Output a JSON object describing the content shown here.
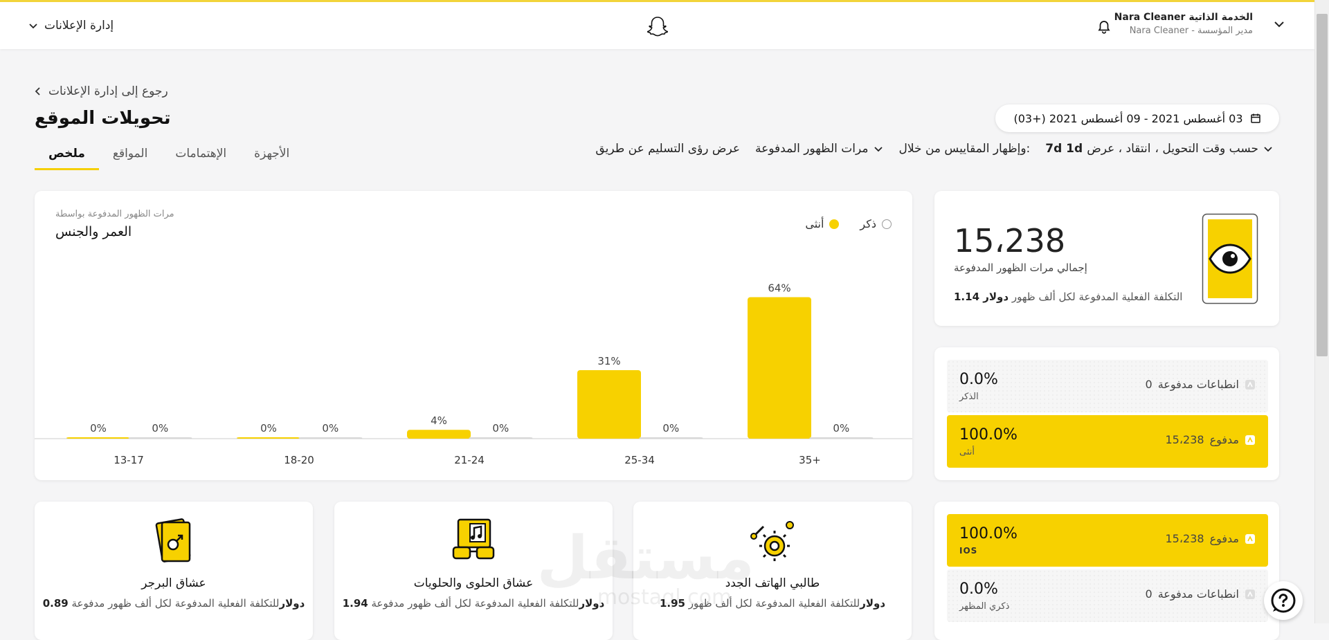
{
  "colors": {
    "accent": "#F7D100",
    "male_dot": "#ffffff",
    "female_dot": "#F7D100",
    "bar": "#F7D100"
  },
  "header": {
    "org_label": "الخدمة الذاتية",
    "org_name": "Nara Cleaner",
    "role_line": "مدير المؤسسة - Nara Cleaner",
    "ads_manager_label": "إدارة الإعلانات",
    "icons": [
      "chevron-down-icon",
      "bell-icon",
      "snapchat-ghost-icon"
    ]
  },
  "page": {
    "back_link": "رجوع إلى إدارة الإعلانات",
    "title": "تحويلات الموقع",
    "date_range": "03 أغسطس 2021 - 09 أغسطس 2021 (+03)",
    "tabs": [
      {
        "label": "ملخص",
        "active": true
      },
      {
        "label": "المواقع",
        "active": false
      },
      {
        "label": "الإهتمامات",
        "active": false
      },
      {
        "label": "الأجهزة",
        "active": false
      }
    ],
    "filters": {
      "by_time": "حسب وقت التحويل ،",
      "attribution_prefix": "انتقاد ، عرض",
      "attribution_strong_1": "7d 1d",
      "show_metrics_via": ":وإظهار المقاييس من خلال",
      "paid_impressions": "مرات الظهور المدفوعة",
      "delivery_insights": "عرض رؤى التسليم عن طريق"
    }
  },
  "age_gender_chart": {
    "subtitle": "مرات الظهور المدفوعة بواسطة",
    "title": "العمر والجنس",
    "legend_male": "ذكر",
    "legend_female": "أنثى"
  },
  "chart_data": {
    "type": "bar",
    "categories": [
      "13-17",
      "18-20",
      "21-24",
      "25-34",
      "35+"
    ],
    "series": [
      {
        "name": "أنثى",
        "values": [
          0,
          0,
          4,
          31,
          64
        ],
        "labels": [
          "0%",
          "0%",
          "4%",
          "31%",
          "64%"
        ]
      },
      {
        "name": "ذكر",
        "values": [
          0,
          0,
          0,
          0,
          0
        ],
        "labels": [
          "0%",
          "0%",
          "0%",
          "0%",
          "0%"
        ]
      }
    ],
    "ylim": [
      0,
      100
    ],
    "legend": "top-right",
    "grid": false
  },
  "impressions": {
    "total": "15،238",
    "label": "إجمالي مرات الظهور المدفوعة",
    "cpm_label": "التكلفة الفعلية المدفوعة لكل ألف ظهور",
    "cpm_value": "دولار 1.14",
    "icon": "eye-phone-icon"
  },
  "gender_breakdown": [
    {
      "percent": "0.0%",
      "name": "الذكر",
      "right_label": "انطباعات مدفوعة",
      "right_value": "0",
      "filled": false,
      "fill_fraction": 0.0
    },
    {
      "percent": "100.0%",
      "name": "أنثى",
      "right_label": "مدفوع",
      "right_value": "15،238",
      "filled": true,
      "fill_fraction": 1.0
    }
  ],
  "appearance_breakdown": [
    {
      "percent": "100.0%",
      "name": "IOS",
      "right_label": "مدفوع",
      "right_value": "15،238",
      "filled": true,
      "fill_fraction": 1.0
    },
    {
      "percent": "0.0%",
      "name": "ذكري المظهر",
      "right_label": "انطباعات مدفوعة",
      "right_value": "0",
      "filled": false,
      "fill_fraction": 0.0
    }
  ],
  "interests": [
    {
      "name": "طالبي الهاتف الجدد",
      "cpm_label": "للتكلفة الفعلية المدفوعة لكل ألف ظهور",
      "currency": "دولار",
      "cpm_value": "1.95",
      "icon": "gears-icon"
    },
    {
      "name": "عشاق الحلوى والحلويات",
      "cpm_label": "للتكلفة الفعلية المدفوعة لكل ألف ظهور مدفوعة",
      "currency": "دولار",
      "cpm_value": "1.94",
      "icon": "music-glasses-icon"
    },
    {
      "name": "عشاق البرجر",
      "cpm_label": "للتكلفة الفعلية المدفوعة لكل ألف ظهور مدفوعة",
      "currency": "دولار",
      "cpm_value": "0.89",
      "icon": "male-cards-icon"
    }
  ],
  "watermark": {
    "arabic": "مستقل",
    "latin": "mostaql.com"
  }
}
